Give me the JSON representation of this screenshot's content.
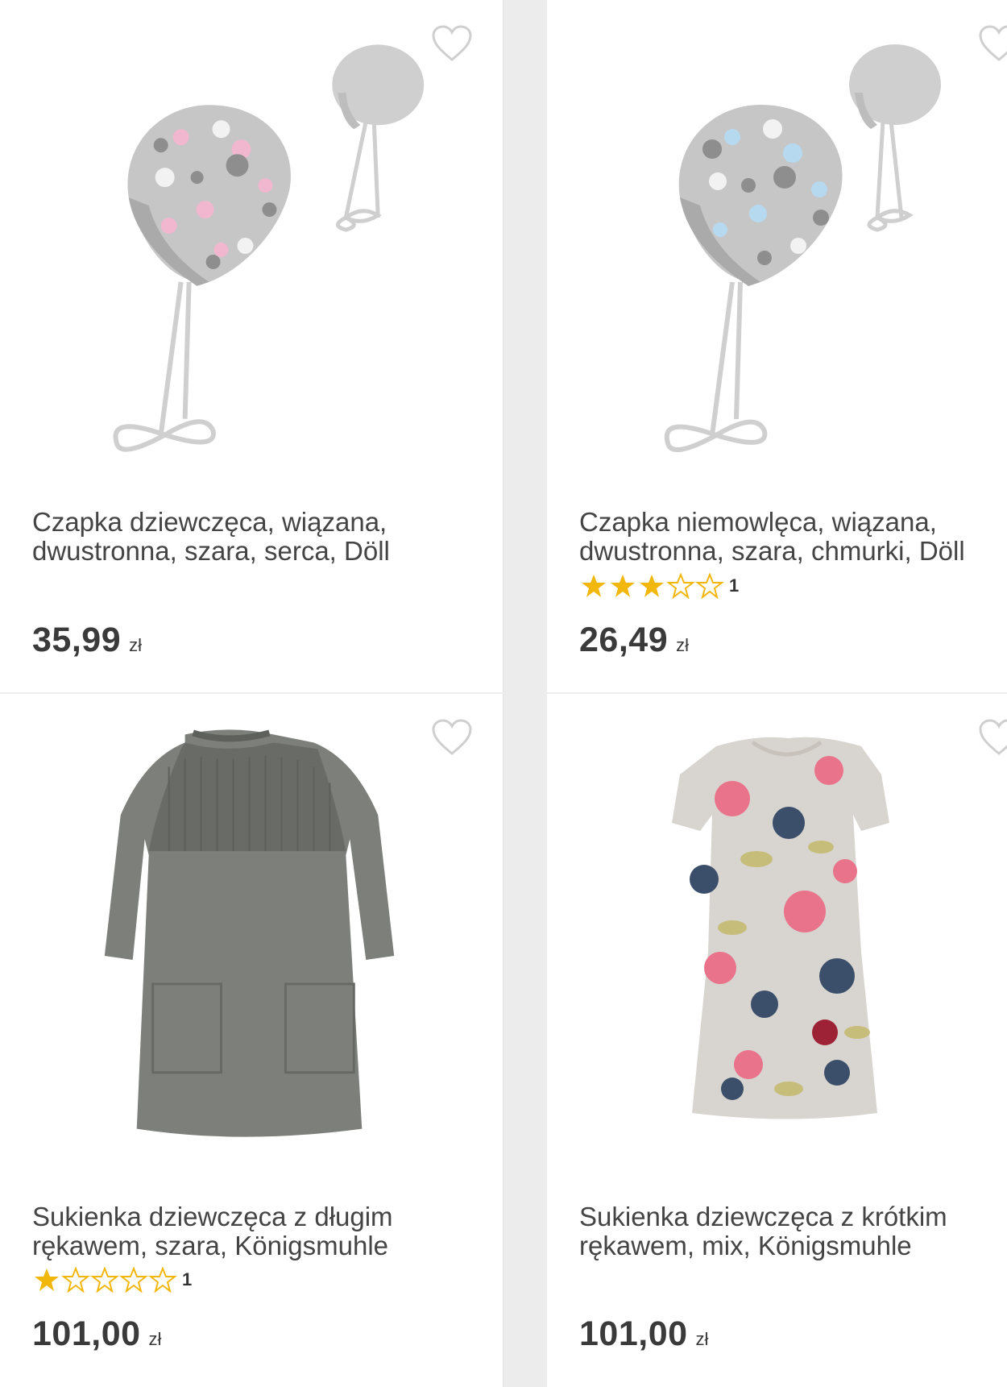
{
  "products": [
    {
      "title": "Czapka dziewczęca, wiązana,\ndwustronna, szara, serca, Döll",
      "price": "35,99",
      "currency": "zł",
      "rating": null,
      "rating_count": null,
      "image_icon": "hat-hearts-image",
      "colors": {
        "base": "#c9c9c9",
        "accent": "#f0b8cf",
        "dark": "#8e8e8e"
      }
    },
    {
      "title": "Czapka niemowlęca, wiązana,\ndwustronna, szara, chmurki, Döll",
      "price": "26,49",
      "currency": "zł",
      "rating": 3,
      "rating_count": "1",
      "image_icon": "hat-clouds-image",
      "colors": {
        "base": "#c9c9c9",
        "accent": "#b6d9f0",
        "dark": "#8e8e8e"
      }
    },
    {
      "title": "Sukienka dziewczęca z długim\nrękawem, szara, Königsmuhle",
      "price": "101,00",
      "currency": "zł",
      "rating": 1,
      "rating_count": "1",
      "image_icon": "grey-knit-dress-image",
      "colors": {
        "base": "#7d7f7a",
        "accent": "#6a6c67",
        "dark": "#5c5e59"
      }
    },
    {
      "title": "Sukienka dziewczęca z krótkim\nrękawem, mix, Königsmuhle",
      "price": "101,00",
      "currency": "zł",
      "rating": null,
      "rating_count": null,
      "image_icon": "floral-dress-image",
      "colors": {
        "base": "#d8d4cf",
        "accent": "#e8738a",
        "dark": "#3b4f6b"
      }
    }
  ],
  "star_color": "#f2b70b"
}
